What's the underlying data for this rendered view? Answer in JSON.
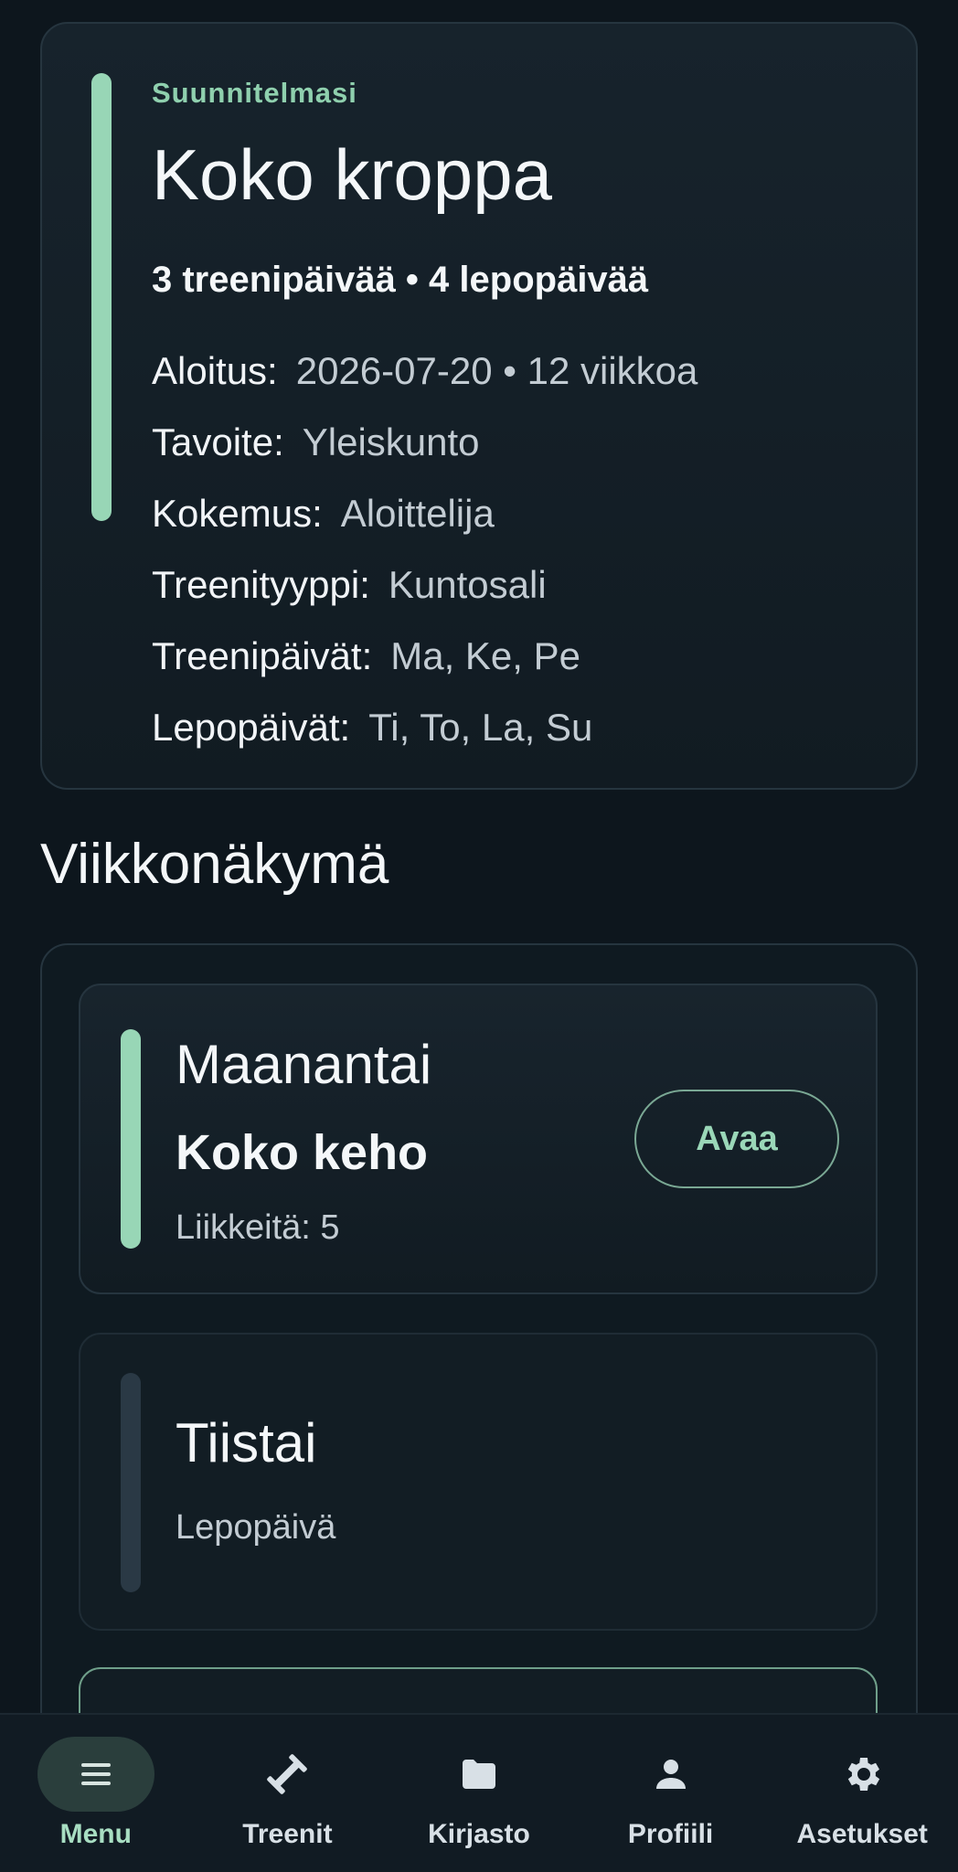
{
  "plan": {
    "kicker": "Suunnitelmasi",
    "title": "Koko kroppa",
    "summary": "3 treenipäivää • 4 lepopäivää",
    "details": [
      {
        "label": "Aloitus:",
        "value": "2026-07-20 • 12 viikkoa"
      },
      {
        "label": "Tavoite:",
        "value": "Yleiskunto"
      },
      {
        "label": "Kokemus:",
        "value": "Aloittelija"
      },
      {
        "label": "Treenityyppi:",
        "value": "Kuntosali"
      },
      {
        "label": "Treenipäivät:",
        "value": "Ma, Ke, Pe"
      },
      {
        "label": "Lepopäivät:",
        "value": "Ti, To, La, Su"
      }
    ]
  },
  "week": {
    "title": "Viikkonäkymä",
    "days": [
      {
        "name": "Maanantai",
        "workout": "Koko keho",
        "sub": "Liikkeitä: 5",
        "button": "Avaa"
      },
      {
        "name": "Tiistai",
        "sub": "Lepopäivä"
      }
    ]
  },
  "nav": {
    "items": [
      {
        "label": "Menu",
        "icon": "menu-icon"
      },
      {
        "label": "Treenit",
        "icon": "dumbbell-icon"
      },
      {
        "label": "Kirjasto",
        "icon": "folder-icon"
      },
      {
        "label": "Profiili",
        "icon": "person-icon"
      },
      {
        "label": "Asetukset",
        "icon": "gear-icon"
      }
    ]
  },
  "colors": {
    "background": "#0d161d",
    "accent_green": "#98d6b6",
    "rest_bar": "#2a3945",
    "nav_active_pill": "#2a3e3c"
  }
}
